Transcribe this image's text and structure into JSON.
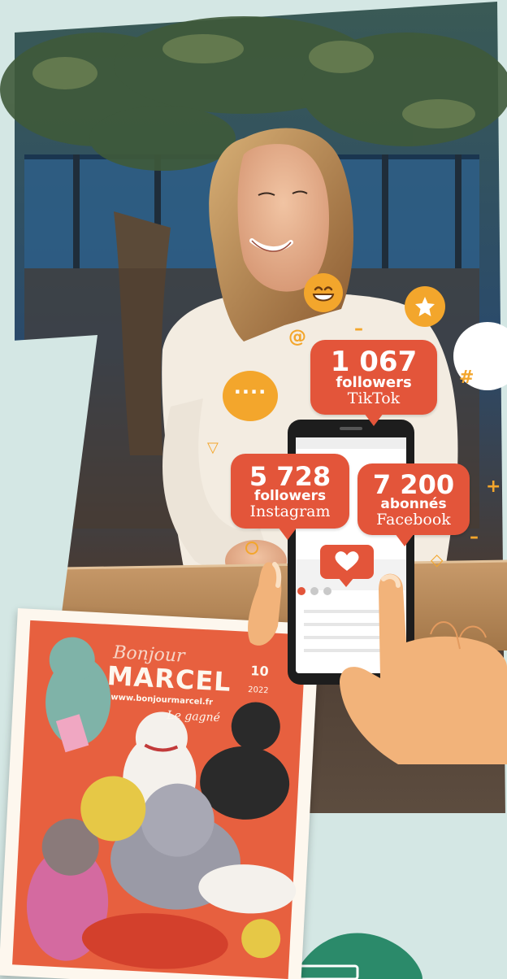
{
  "stats": [
    {
      "value": "1 067",
      "unit": "followers",
      "network": "TikTok"
    },
    {
      "value": "5 728",
      "unit": "followers",
      "network": "Instagram"
    },
    {
      "value": "7 200",
      "unit": "abonnés",
      "network": "Facebook"
    }
  ],
  "decor": {
    "at_symbol": "@",
    "hash_symbol": "#",
    "plus_symbol": "+",
    "dots": "····",
    "triangle": "▽",
    "diamond": "◇",
    "dash": "–"
  },
  "poster": {
    "title_script": "Bonjour",
    "title_main": "MARCEL",
    "url": "www.bonjourmarcel.fr",
    "issue": "10",
    "date": "2022",
    "tagline": "Le gagné"
  },
  "colors": {
    "bubble": "#e3553a",
    "accent_yellow": "#f3a62c",
    "mint": "#d4e7e4",
    "poster_orange": "#e7603f"
  }
}
